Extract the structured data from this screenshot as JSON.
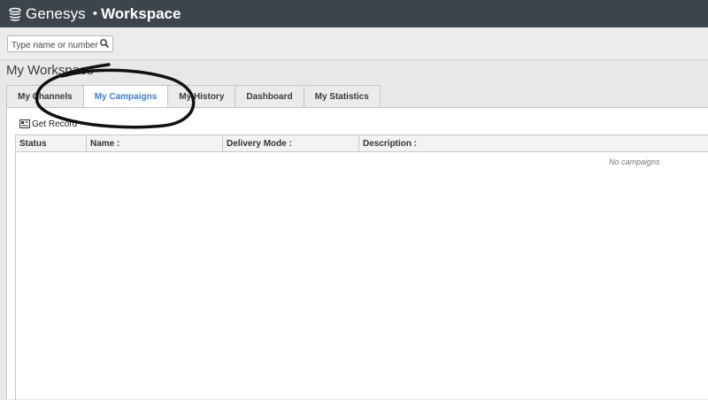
{
  "header": {
    "brand": "Genesys",
    "separator": "•",
    "app_name": "Workspace"
  },
  "search": {
    "placeholder": "Type name or number",
    "value": ""
  },
  "page_title": "My Workspace",
  "tabs": [
    {
      "label": "My Channels",
      "active": false
    },
    {
      "label": "My Campaigns",
      "active": true
    },
    {
      "label": "My History",
      "active": false
    },
    {
      "label": "Dashboard",
      "active": false
    },
    {
      "label": "My Statistics",
      "active": false
    }
  ],
  "toolbar": {
    "get_record_label": "Get Record"
  },
  "table": {
    "columns": [
      "Status",
      "Name :",
      "Delivery Mode :",
      "Description :"
    ],
    "empty_message": "No campaigns"
  },
  "colors": {
    "topbar": "#3d454c",
    "active_tab_text": "#3a7fd5",
    "annotation_stroke": "#111111"
  },
  "icons": {
    "logo": "genesys-logo-icon",
    "search": "search-icon",
    "get_record": "get-record-icon"
  }
}
